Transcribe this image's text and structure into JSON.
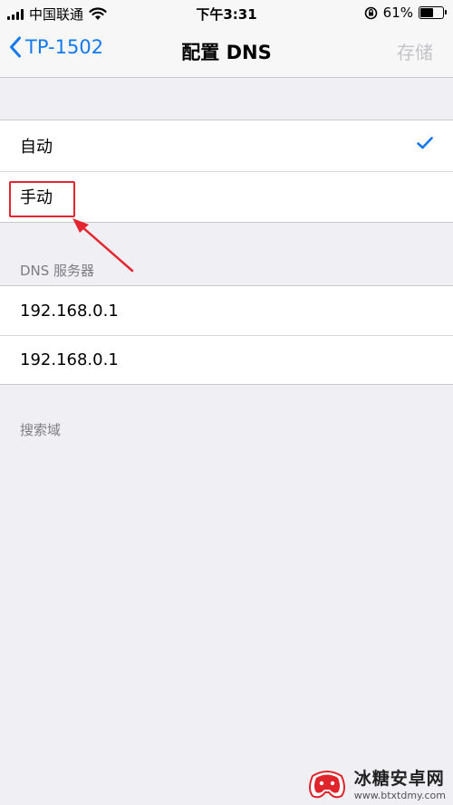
{
  "status_bar": {
    "carrier": "中国联通",
    "time": "下午3:31",
    "battery_percent": "61%",
    "battery_level": 0.61
  },
  "nav": {
    "back_label": "TP-1502",
    "title": "配置 DNS",
    "save_label": "存储"
  },
  "dns_mode": {
    "options": [
      {
        "label": "自动",
        "selected": true
      },
      {
        "label": "手动",
        "selected": false
      }
    ]
  },
  "dns_servers": {
    "header": "DNS 服务器",
    "items": [
      "192.168.0.1",
      "192.168.0.1"
    ]
  },
  "search_domains": {
    "header": "搜索域"
  },
  "watermark": {
    "title": "冰糖安卓网",
    "url": "www.btxtdmy.com"
  },
  "colors": {
    "accent": "#1478f0",
    "annotation": "#e3262f",
    "background": "#efeff4"
  }
}
